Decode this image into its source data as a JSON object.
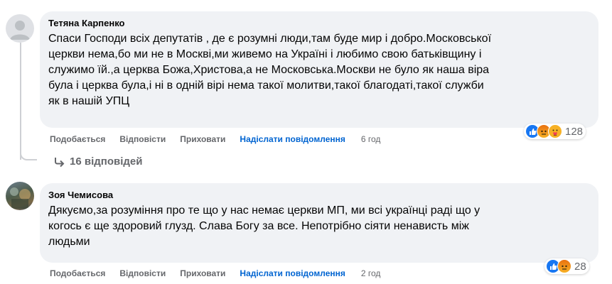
{
  "comments": [
    {
      "author": "Тетяна Карпенко",
      "text": [
        "Спаси Господи всіх депутатів , де є розумні люди,там буде мир і добро.Московської",
        "церкви нема,бо ми не в Москві,ми живемо на Україні і любимо свою батьківщину і",
        "служимо їй.,а церква Божа,Христова,а не Московська.Москви не було як наша віра",
        "була і церква була,і ні в одній вірі нема такої молитви,такої благодаті,такої служби",
        "як в нашій УПЦ"
      ],
      "like_label": "Подобається",
      "reply_label": "Відповісти",
      "hide_label": "Приховати",
      "send_label": "Надіслати повідомлення",
      "time": "6 год",
      "reaction_count": "128",
      "reactions": [
        "like-icon",
        "angry-icon",
        "care-icon"
      ]
    },
    {
      "author": "Зоя Чемисова",
      "text": [
        "Дякуємо,за розуміння про те що у нас немає церкви МП, ми всі українці раді що у",
        "когось є ще здоровий глузд. Слава Богу за все. Непотрібно сіяти ненависть між",
        "людьми"
      ],
      "like_label": "Подобається",
      "reply_label": "Відповісти",
      "hide_label": "Приховати",
      "send_label": "Надіслати повідомлення",
      "time": "2 год",
      "reaction_count": "28",
      "reactions": [
        "like-icon",
        "angry-icon"
      ]
    }
  ],
  "replies_link": "16 відповідей",
  "colors": {
    "bubble": "#f0f2f5",
    "link": "#0064d1",
    "muted": "#65676b"
  }
}
